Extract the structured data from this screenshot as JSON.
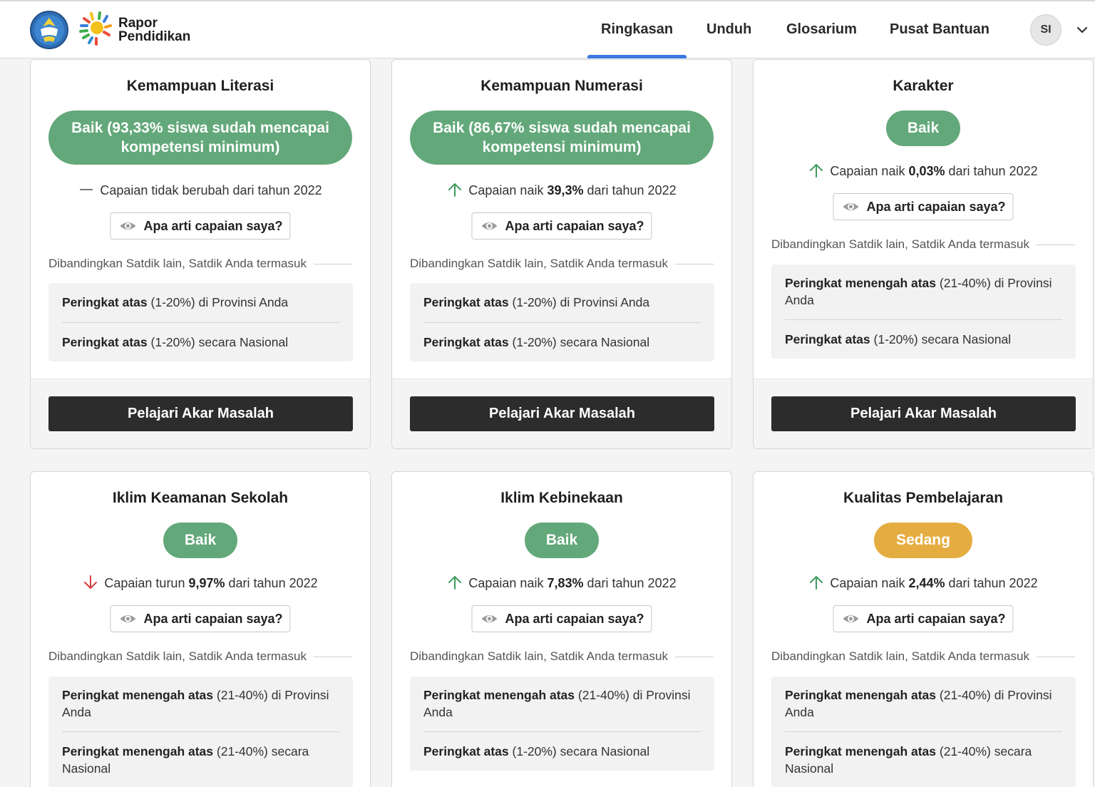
{
  "brand": {
    "line1": "Rapor",
    "line2": "Pendidikan"
  },
  "nav": {
    "items": [
      {
        "label": "Ringkasan",
        "active": true
      },
      {
        "label": "Unduh"
      },
      {
        "label": "Glosarium"
      },
      {
        "label": "Pusat Bantuan"
      }
    ],
    "avatar": "SI"
  },
  "colors": {
    "good": "#63a87a",
    "medium": "#e5ad41",
    "up": "#3f9a5f",
    "down": "#d63a3a",
    "nav_active": "#3a78e0"
  },
  "common": {
    "meaning_button": "Apa arti capaian saya?",
    "compare_label": "Dibandingkan Satdik lain, Satdik Anda termasuk",
    "cta": "Pelajari Akar Masalah"
  },
  "cards": [
    {
      "title": "Kemampuan Literasi",
      "status": "Baik (93,33% siswa sudah mencapai kompetensi minimum)",
      "status_level": "good",
      "trend": "flat",
      "change_pre": "Capaian tidak berubah dari tahun 2022",
      "change_val": "",
      "change_post": "",
      "ranks": [
        {
          "bold": "Peringkat atas",
          "rest": " (1-20%) di Provinsi Anda"
        },
        {
          "bold": "Peringkat atas",
          "rest": " (1-20%) secara Nasional"
        }
      ]
    },
    {
      "title": "Kemampuan Numerasi",
      "status": "Baik (86,67% siswa sudah mencapai kompetensi minimum)",
      "status_level": "good",
      "trend": "up",
      "change_pre": "Capaian naik ",
      "change_val": "39,3%",
      "change_post": " dari tahun 2022",
      "ranks": [
        {
          "bold": "Peringkat atas",
          "rest": " (1-20%) di Provinsi Anda"
        },
        {
          "bold": "Peringkat atas",
          "rest": " (1-20%) secara Nasional"
        }
      ]
    },
    {
      "title": "Karakter",
      "status": "Baik",
      "status_level": "good",
      "trend": "up",
      "change_pre": "Capaian naik ",
      "change_val": "0,03%",
      "change_post": " dari tahun 2022",
      "ranks": [
        {
          "bold": "Peringkat menengah atas",
          "rest": " (21-40%) di Provinsi Anda"
        },
        {
          "bold": "Peringkat atas",
          "rest": " (1-20%) secara Nasional"
        }
      ]
    },
    {
      "title": "Iklim Keamanan Sekolah",
      "status": "Baik",
      "status_level": "good",
      "trend": "down",
      "change_pre": "Capaian turun ",
      "change_val": "9,97%",
      "change_post": " dari tahun 2022",
      "ranks": [
        {
          "bold": "Peringkat menengah atas",
          "rest": " (21-40%) di Provinsi Anda"
        },
        {
          "bold": "Peringkat menengah atas",
          "rest": " (21-40%) secara Nasional"
        }
      ]
    },
    {
      "title": "Iklim Kebinekaan",
      "status": "Baik",
      "status_level": "good",
      "trend": "up",
      "change_pre": "Capaian naik ",
      "change_val": "7,83%",
      "change_post": " dari tahun 2022",
      "ranks": [
        {
          "bold": "Peringkat menengah atas",
          "rest": " (21-40%) di Provinsi Anda"
        },
        {
          "bold": "Peringkat atas",
          "rest": " (1-20%) secara Nasional"
        }
      ]
    },
    {
      "title": "Kualitas Pembelajaran",
      "status": "Sedang",
      "status_level": "medium",
      "trend": "up",
      "change_pre": "Capaian naik ",
      "change_val": "2,44%",
      "change_post": " dari tahun 2022",
      "ranks": [
        {
          "bold": "Peringkat menengah atas",
          "rest": " (21-40%) di Provinsi Anda"
        },
        {
          "bold": "Peringkat menengah atas",
          "rest": " (21-40%) secara Nasional"
        }
      ]
    }
  ]
}
